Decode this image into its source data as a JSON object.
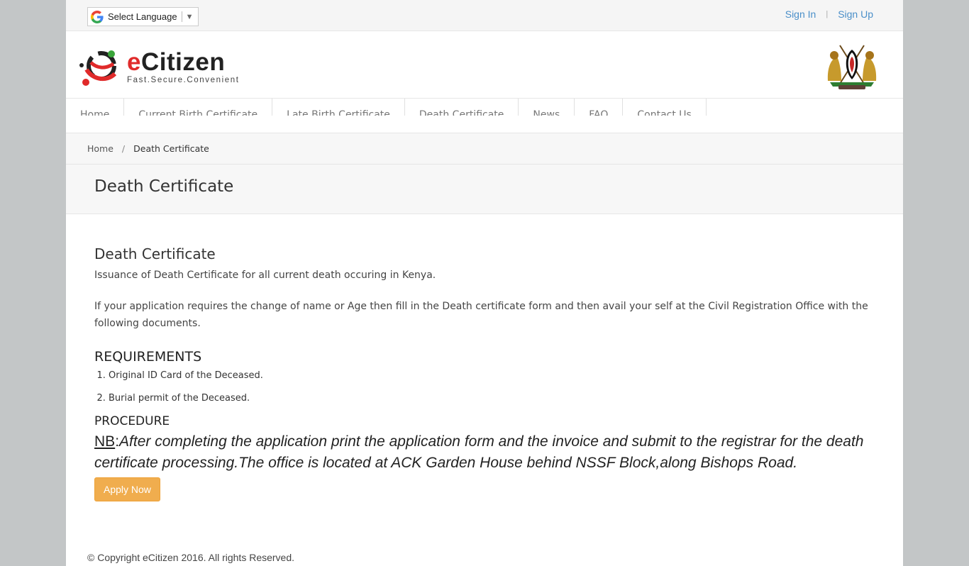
{
  "topbar": {
    "language_label": "Select Language",
    "sign_in": "Sign In",
    "separator": "|",
    "sign_up": "Sign Up"
  },
  "header": {
    "brand_prefix": "e",
    "brand_rest": "Citizen",
    "tagline": "Fast.Secure.Convenient"
  },
  "nav": {
    "items": [
      {
        "label": "Home"
      },
      {
        "label": "Current Birth Certificate"
      },
      {
        "label": "Late Birth Certificate"
      },
      {
        "label": "Death Certificate"
      },
      {
        "label": "News"
      },
      {
        "label": "FAQ"
      },
      {
        "label": "Contact Us"
      }
    ]
  },
  "breadcrumb": {
    "home": "Home",
    "slash": "/",
    "current": "Death Certificate"
  },
  "page": {
    "title": "Death Certificate"
  },
  "content": {
    "heading": "Death Certificate",
    "intro": "Issuance of Death Certificate for all current death occuring in Kenya.",
    "note": "If your application requires the change of name or Age then fill in the Death certificate form and then avail your self at the Civil Registration Office with the following documents.",
    "requirements_heading": "REQUIREMENTS",
    "requirements": [
      "Original ID Card of the Deceased.",
      "Burial permit of the Deceased."
    ],
    "procedure_heading": "PROCEDURE",
    "nb_label": "NB",
    "nb_colon": ":",
    "nb_text": "After completing the application print the application form and the invoice and submit to the registrar for the death certificate processing.The office is located at ACK Garden House behind NSSF Block,along Bishops Road.",
    "apply_label": "Apply Now"
  },
  "footer": {
    "copyright": "© Copyright eCitizen 2016. All rights Reserved."
  },
  "colors": {
    "link_blue": "#4a8fc9",
    "brand_red": "#e02a2a",
    "apply_orange": "#f0ad4e",
    "background": "#c3c6c7"
  },
  "icons": [
    "google-g-icon",
    "dropdown-arrow-icon",
    "ecitizen-logo-icon",
    "kenya-coat-of-arms-icon"
  ]
}
